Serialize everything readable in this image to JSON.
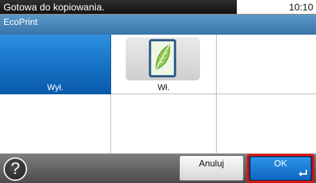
{
  "status": {
    "message": "Gotowa do kopiowania.",
    "time": "10:10"
  },
  "title": "EcoPrint",
  "options": [
    {
      "label": "Wył.",
      "selected": true
    },
    {
      "label": "Wł.",
      "selected": false,
      "icon": "ecoprint-leaf-icon"
    }
  ],
  "footer": {
    "help_label": "?",
    "cancel_label": "Anuluj",
    "ok_label": "OK"
  },
  "colors": {
    "selected": "#1571c4",
    "title_bar": "#3f7fb5",
    "highlight": "#e2121b"
  }
}
